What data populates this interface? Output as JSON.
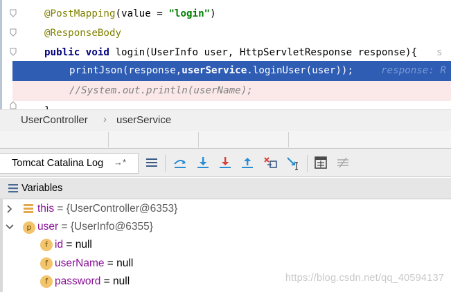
{
  "editor": {
    "line1": {
      "annotation": "@PostMapping",
      "open": "(value = ",
      "string": "\"login\"",
      "close": ")"
    },
    "line2": {
      "annotation": "@ResponseBody"
    },
    "line3": {
      "kw1": "public",
      "kw2": "void",
      "rest": " login(UserInfo user, HttpServletResponse response){",
      "trail": "s"
    },
    "line4": {
      "prefix": "printJson(response,",
      "bold": "userService",
      "suffix": ".loginUser(user));",
      "hint": "response: R"
    },
    "line5": {
      "comment": "//System.out.println(userName);"
    },
    "line6": {
      "text": "}"
    }
  },
  "breadcrumb": {
    "items": [
      "UserController",
      "userService"
    ],
    "separator": "›"
  },
  "toolbar": {
    "tab_label": "Tomcat Catalina Log",
    "tab_pin": "→*",
    "buttons": [
      "show-execution-point",
      "step-over",
      "step-into",
      "force-step-into",
      "step-out",
      "drop-frame",
      "run-to-cursor",
      "evaluate-expression",
      "trace-current-stream"
    ]
  },
  "variables": {
    "title": "Variables",
    "items": [
      {
        "name": "this",
        "value": " = {UserController@6353}",
        "icon": "stack-icon",
        "expanded": false
      },
      {
        "name": "user",
        "value": " = {UserInfo@6355}",
        "icon": "p",
        "expanded": true
      },
      {
        "name": "id",
        "value": " = null",
        "icon": "f"
      },
      {
        "name": "userName",
        "value": " = null",
        "icon": "f"
      },
      {
        "name": "password",
        "value": " = null",
        "icon": "f"
      }
    ]
  },
  "watermark": "https://blog.csdn.net/qq_40594137",
  "colors": {
    "selection": "#2f5db4",
    "breakpoint_line": "#fbe9e9",
    "annotation": "#808000",
    "keyword": "#000080",
    "string": "#008000",
    "variable_name": "#871094",
    "field_icon": "#f2c46b"
  }
}
